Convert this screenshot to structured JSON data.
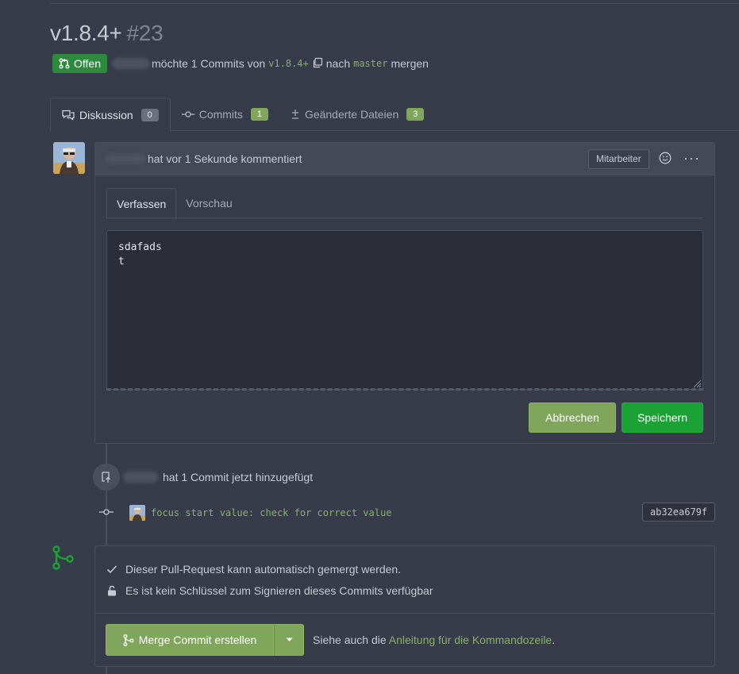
{
  "header": {
    "title": "v1.8.4+",
    "number": "#23",
    "state_label": "Offen",
    "sub_text_1": "möchte 1 Commits von",
    "head_branch": "v1.8.4+",
    "sub_text_2": "nach",
    "base_branch": "master",
    "sub_text_3": "mergen"
  },
  "tabs": [
    {
      "label": "Diskussion",
      "count": "0"
    },
    {
      "label": "Commits",
      "count": "1"
    },
    {
      "label": "Geänderte Dateien",
      "count": "3"
    }
  ],
  "comment": {
    "header_text": "hat vor 1 Sekunde kommentiert",
    "role": "Mitarbeiter",
    "more": "···",
    "editor_tabs": [
      "Verfassen",
      "Vorschau"
    ],
    "content": "sdafads\nt",
    "cancel_label": "Abbrechen",
    "save_label": "Speichern"
  },
  "commit_event": {
    "text": "hat 1 Commit jetzt hinzugefügt",
    "message": "focus start value: check for correct value",
    "sha": "ab32ea679f"
  },
  "merge": {
    "check_1": "Dieser Pull-Request kann automatisch gemergt werden.",
    "check_2": "Es ist kein Schlüssel zum Signieren dieses Commits verfügbar",
    "button_label": "Merge Commit erstellen",
    "hint_prefix": "Siehe auch die",
    "hint_link": "Anleitung für die Kommandozeile",
    "hint_suffix": "."
  },
  "colors": {
    "background": "#383c4a",
    "accent_green": "#7fa65b",
    "save_green": "#1aa334",
    "open_badge": "#2e8b3d"
  }
}
